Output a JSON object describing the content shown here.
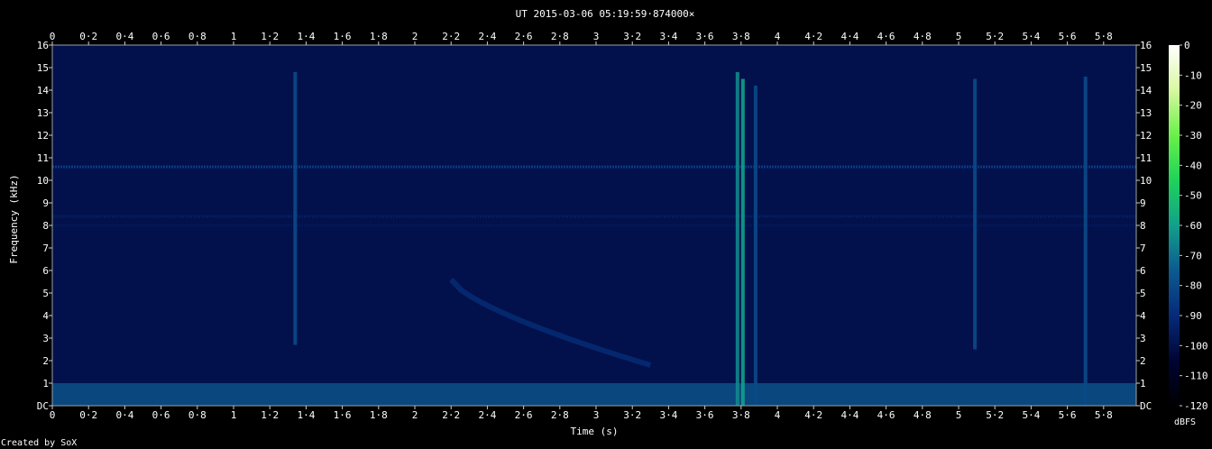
{
  "chart_data": {
    "type": "heatmap",
    "title": "UT 2015-03-06 05:19:59·874000×",
    "xlabel": "Time (s)",
    "ylabel": "Frequency (kHz)",
    "footer": "Created by SoX",
    "colorbar_label": "dBFS",
    "xlim": [
      0,
      5.98
    ],
    "ylim": [
      0,
      16
    ],
    "x_ticks": [
      "0",
      "0·2",
      "0·4",
      "0·6",
      "0·8",
      "1",
      "1·2",
      "1·4",
      "1·6",
      "1·8",
      "2",
      "2·2",
      "2·4",
      "2·6",
      "2·8",
      "3",
      "3·2",
      "3·4",
      "3·6",
      "3·8",
      "4",
      "4·2",
      "4·4",
      "4·6",
      "4·8",
      "5",
      "5·2",
      "5·4",
      "5·6",
      "5·8"
    ],
    "y_ticks": [
      "DC",
      "1",
      "2",
      "3",
      "4",
      "5",
      "6",
      "7",
      "8",
      "9",
      "10",
      "11",
      "12",
      "13",
      "14",
      "15",
      "16"
    ],
    "colorbar_ticks": [
      "0",
      "-10",
      "-20",
      "-30",
      "-40",
      "-50",
      "-60",
      "-70",
      "-80",
      "-90",
      "-100",
      "-110",
      "-120"
    ],
    "colorbar_range_dbfs": [
      -120,
      0
    ],
    "colormap": [
      "#000000",
      "#000433",
      "#062a7a",
      "#0d5a8f",
      "#12a08a",
      "#1ed35a",
      "#6af04a",
      "#d8f8a0",
      "#ffffff"
    ],
    "background_level_dbfs": -100,
    "low_frequency_band": {
      "freq_khz": [
        0,
        1
      ],
      "level_dbfs": -75
    },
    "horizontal_tones": [
      {
        "freq_khz": 10.6,
        "level_dbfs": -85
      },
      {
        "freq_khz": 8.4,
        "level_dbfs": -95
      },
      {
        "freq_khz": 8.0,
        "level_dbfs": -97
      }
    ],
    "vertical_events": [
      {
        "time_s": 1.34,
        "freq_range_khz": [
          2.7,
          14.8
        ],
        "level_dbfs": -80
      },
      {
        "time_s": 3.78,
        "freq_range_khz": [
          0,
          14.8
        ],
        "level_dbfs": -65
      },
      {
        "time_s": 3.81,
        "freq_range_khz": [
          0,
          14.5
        ],
        "level_dbfs": -60
      },
      {
        "time_s": 3.88,
        "freq_range_khz": [
          0,
          14.2
        ],
        "level_dbfs": -80
      },
      {
        "time_s": 5.09,
        "freq_range_khz": [
          2.5,
          14.5
        ],
        "level_dbfs": -80
      },
      {
        "time_s": 5.7,
        "freq_range_khz": [
          0,
          14.6
        ],
        "level_dbfs": -80
      }
    ],
    "sweep": {
      "time_range_s": [
        2.2,
        3.3
      ],
      "freq_range_khz": [
        5.6,
        1.8
      ],
      "level_dbfs": -88
    }
  }
}
